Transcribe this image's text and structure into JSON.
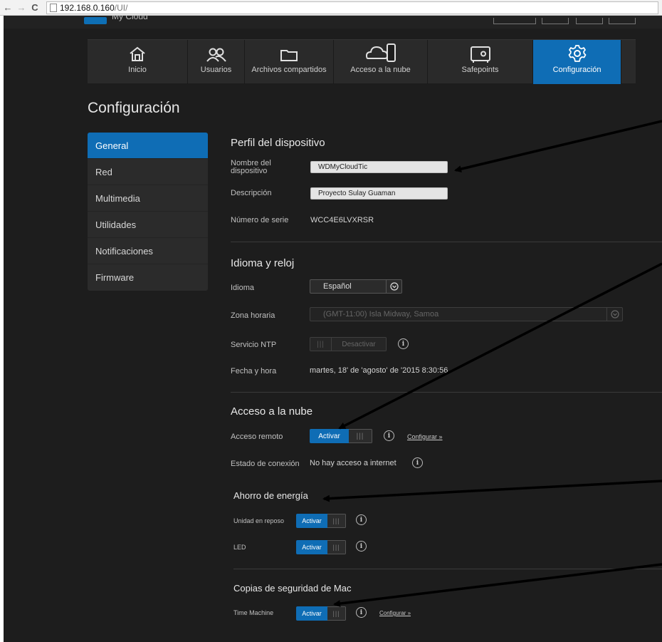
{
  "browser": {
    "url_host": "192.168.0.160",
    "url_path": "/UI/"
  },
  "app": {
    "brand": "My Cloud"
  },
  "nav": [
    {
      "id": "inicio",
      "label": "Inicio",
      "icon": "home-icon"
    },
    {
      "id": "usuarios",
      "label": "Usuarios",
      "icon": "users-icon"
    },
    {
      "id": "archivos",
      "label": "Archivos compartidos",
      "icon": "folder-icon"
    },
    {
      "id": "nube",
      "label": "Acceso a la nube",
      "icon": "cloud-device-icon"
    },
    {
      "id": "safepoints",
      "label": "Safepoints",
      "icon": "safe-icon"
    },
    {
      "id": "config",
      "label": "Configuración",
      "icon": "gear-icon",
      "active": true
    }
  ],
  "page_title": "Configuración",
  "sidebar": [
    {
      "label": "General",
      "active": true
    },
    {
      "label": "Red"
    },
    {
      "label": "Multimedia"
    },
    {
      "label": "Utilidades"
    },
    {
      "label": "Notificaciones"
    },
    {
      "label": "Firmware"
    }
  ],
  "perfil": {
    "title": "Perfil del dispositivo",
    "name_label": "Nombre del dispositivo",
    "name_value": "WDMyCloudTic",
    "desc_label": "Descripción",
    "desc_value": "Proyecto Sulay Guaman",
    "serial_label": "Número de serie",
    "serial_value": "WCC4E6LVXRSR"
  },
  "idioma": {
    "title": "Idioma y reloj",
    "lang_label": "Idioma",
    "lang_value": "Español",
    "tz_label": "Zona horaria",
    "tz_value": "(GMT-11:00) Isla Midway, Samoa",
    "ntp_label": "Servicio NTP",
    "ntp_value": "Desactivar",
    "date_label": "Fecha y hora",
    "date_value": "martes, 18' de 'agosto' de '2015 8:30:56"
  },
  "nube": {
    "title": "Acceso a la nube",
    "remote_label": "Acceso remoto",
    "remote_value": "Activar",
    "configure": "Configurar »",
    "status_label": "Estado de conexión",
    "status_value": "No hay acceso a internet"
  },
  "ahorro": {
    "title": "Ahorro de energía",
    "sleep_label": "Unidad en reposo",
    "sleep_value": "Activar",
    "led_label": "LED",
    "led_value": "Activar"
  },
  "mac": {
    "title": "Copias de seguridad de Mac",
    "tm_label": "Time Machine",
    "tm_value": "Activar",
    "configure": "Configurar »"
  },
  "grip": "|||",
  "colors": {
    "accent": "#0f6db5",
    "background": "#1d1d1d",
    "panel": "#2b2b2b"
  }
}
